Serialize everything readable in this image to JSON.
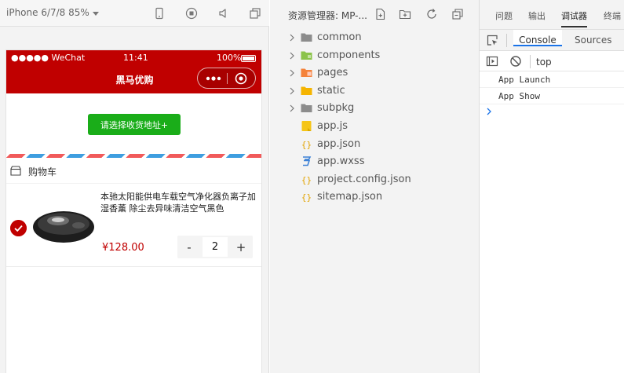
{
  "simulator": {
    "device_label": "iPhone 6/7/8 85%",
    "status_bar": {
      "carrier": "●●●●● WeChat",
      "time": "11:41",
      "battery": "100%"
    },
    "nav_title": "黑马优购",
    "address_button": "请选择收货地址+",
    "cart_title": "购物车",
    "goods": {
      "name": "本驰太阳能供电车载空气净化器负离子加湿香薰 除尘去异味清洁空气黑色",
      "price": "¥128.00",
      "quantity": "2",
      "minus": "-",
      "plus": "+"
    },
    "colors": {
      "nav_bg": "#c00000",
      "address_button": "#1aad19",
      "price": "#c00000"
    }
  },
  "explorer": {
    "title": "资源管理器: MP-...",
    "items": [
      {
        "label": "common",
        "type": "folder",
        "icon": "folder-gray-icon"
      },
      {
        "label": "components",
        "type": "folder",
        "icon": "folder-green-icon"
      },
      {
        "label": "pages",
        "type": "folder",
        "icon": "folder-orange-icon"
      },
      {
        "label": "static",
        "type": "folder",
        "icon": "folder-yellow-icon"
      },
      {
        "label": "subpkg",
        "type": "folder",
        "icon": "folder-gray-icon"
      },
      {
        "label": "app.js",
        "type": "file",
        "icon": "js-file-icon"
      },
      {
        "label": "app.json",
        "type": "file",
        "icon": "json-file-icon"
      },
      {
        "label": "app.wxss",
        "type": "file",
        "icon": "css-file-icon"
      },
      {
        "label": "project.config.json",
        "type": "file",
        "icon": "json-file-icon"
      },
      {
        "label": "sitemap.json",
        "type": "file",
        "icon": "json-file-icon"
      }
    ]
  },
  "debugger": {
    "tabs": [
      "问题",
      "输出",
      "调试器",
      "终端"
    ],
    "active_tab": "调试器",
    "devtools_tabs": {
      "console": "Console",
      "sources": "Sources"
    },
    "context": "top",
    "logs": [
      "App  Launch",
      "App  Show"
    ]
  }
}
